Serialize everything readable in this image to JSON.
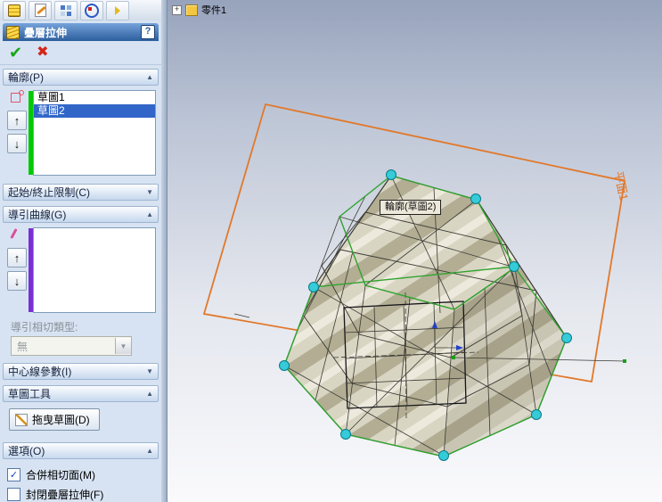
{
  "icons": {
    "plus": "+",
    "help": "?",
    "ok": "✔",
    "cancel": "✖",
    "up": "↑",
    "down": "↓",
    "chevron_up": "▲",
    "chevron_down": "▼",
    "dropdown_arrow": "▼",
    "check": "✓"
  },
  "feature_tree": {
    "part_label": "零件1"
  },
  "panel": {
    "title": "疊層拉伸",
    "sections": {
      "profiles": {
        "title": "輪廓(P)",
        "items": [
          {
            "label": "草圖1",
            "selected": false
          },
          {
            "label": "草圖2",
            "selected": true
          }
        ]
      },
      "start_end": {
        "title": "起始/終止限制(C)"
      },
      "guide_curves": {
        "title": "導引曲線(G)",
        "tangency_label": "導引相切類型:",
        "tangency_value": "無"
      },
      "centerline": {
        "title": "中心線參數(I)"
      },
      "sketch_tools": {
        "title": "草圖工具",
        "drag_button": "拖曳草圖(D)"
      },
      "options": {
        "title": "選項(O)",
        "merge_tangent": {
          "label": "合併相切面(M)",
          "checked": true
        },
        "close_loft": {
          "label": "封閉疊層拉伸(F)",
          "checked": false
        }
      }
    }
  },
  "viewport": {
    "plane_label": "平面1",
    "tooltip": "輪廓(草圖2)"
  },
  "colors": {
    "accent_orange": "#e2782a",
    "selection_blue": "#3166c8",
    "profile_green": "#00ca00",
    "guide_purple": "#7a2fd6",
    "vertex_cyan": "#35cbd8"
  }
}
